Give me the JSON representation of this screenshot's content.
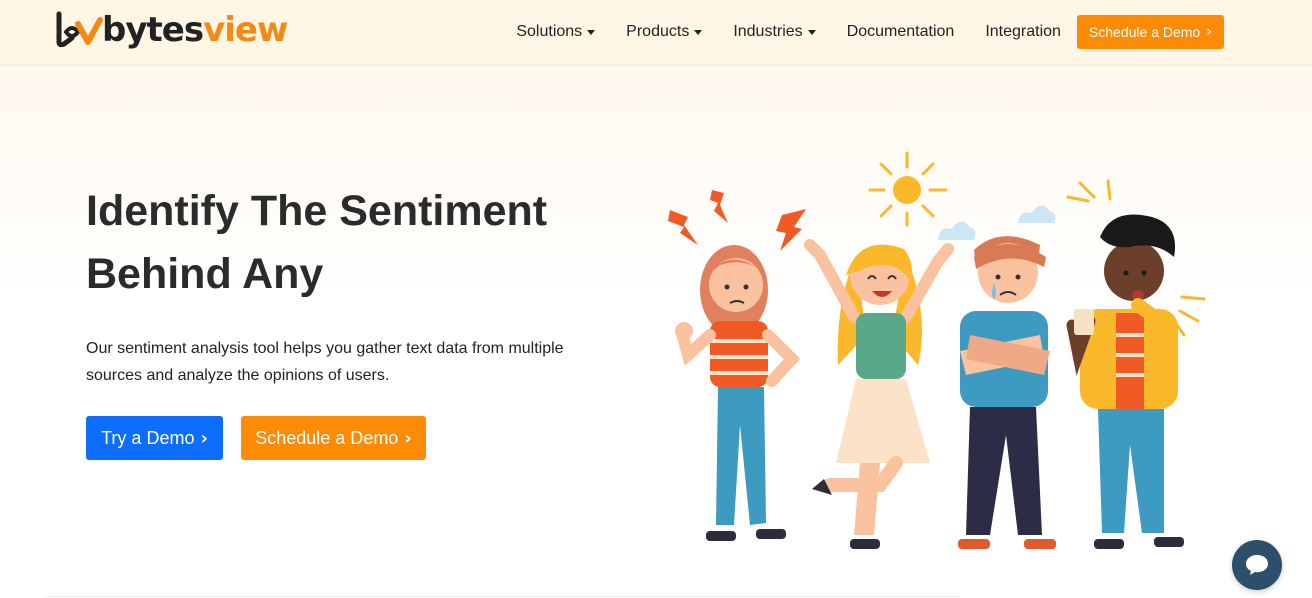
{
  "header": {
    "logo": {
      "text_dark": "bytes",
      "text_accent": "view"
    },
    "nav": [
      {
        "label": "Solutions",
        "dropdown": true
      },
      {
        "label": "Products",
        "dropdown": true
      },
      {
        "label": "Industries",
        "dropdown": true
      },
      {
        "label": "Documentation",
        "dropdown": false
      },
      {
        "label": "Integration",
        "dropdown": false
      }
    ],
    "cta_label": "Schedule a Demo"
  },
  "hero": {
    "title_line1": "Identify The Sentiment",
    "title_line2": "Behind Any",
    "description": "Our sentiment analysis tool helps you gather text data from multiple sources and analyze the opinions of users.",
    "try_demo_label": "Try a Demo",
    "schedule_demo_label": "Schedule a Demo"
  },
  "icons": {
    "chevron": "chevron-right-icon",
    "caret": "caret-down-icon",
    "chat": "chat-bubble-icon"
  },
  "colors": {
    "accent_orange": "#fd8b05",
    "primary_blue": "#0d6efd",
    "chat_bg": "#2e4f6b",
    "header_bg": "#fff6e6"
  }
}
